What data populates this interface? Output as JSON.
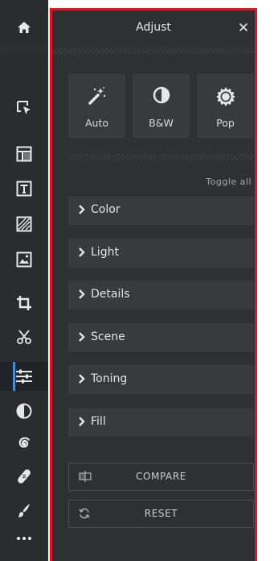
{
  "toolbar": {
    "items": [
      {
        "icon": "home-icon"
      },
      {
        "icon": "select-arrow-icon"
      },
      {
        "icon": "layout-icon"
      },
      {
        "icon": "text-icon"
      },
      {
        "icon": "texture-icon"
      },
      {
        "icon": "image-icon"
      },
      {
        "icon": "crop-icon"
      },
      {
        "icon": "cutout-scissors-icon"
      },
      {
        "icon": "adjust-sliders-icon",
        "active": true
      },
      {
        "icon": "contrast-circle-icon"
      },
      {
        "icon": "spiral-effects-icon"
      },
      {
        "icon": "bandage-retouch-icon"
      },
      {
        "icon": "brush-icon"
      },
      {
        "icon": "more-dots-icon"
      }
    ],
    "active_color": "#3d8fd6"
  },
  "panel": {
    "title": "Adjust",
    "close_symbol": "✕",
    "border_color": "#e8121b",
    "quick_actions": [
      {
        "label": "Auto",
        "icon": "magic-wand-icon"
      },
      {
        "label": "B&W",
        "icon": "half-circle-icon"
      },
      {
        "label": "Pop",
        "icon": "sun-burst-icon"
      }
    ],
    "toggle_all": "Toggle all",
    "sections": [
      {
        "label": "Color"
      },
      {
        "label": "Light"
      },
      {
        "label": "Details"
      },
      {
        "label": "Scene"
      },
      {
        "label": "Toning"
      },
      {
        "label": "Fill"
      }
    ],
    "compare_label": "COMPARE",
    "reset_label": "RESET"
  }
}
